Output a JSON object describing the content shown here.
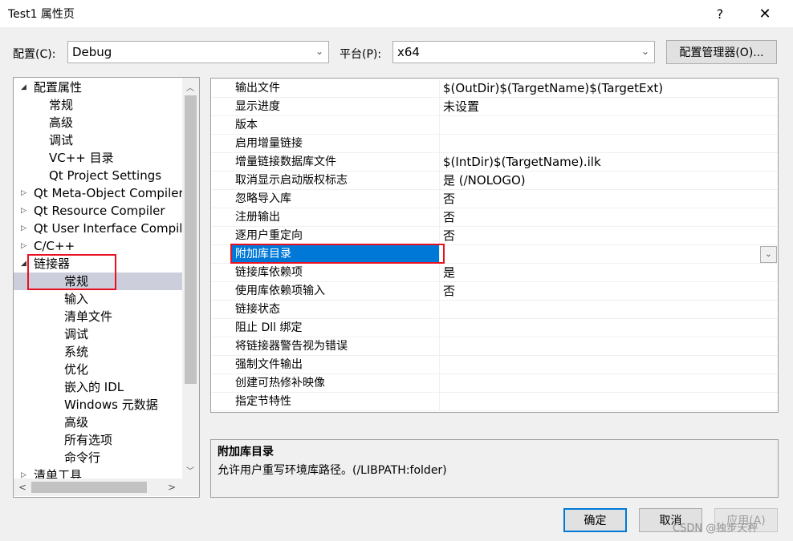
{
  "window": {
    "title": "Test1 属性页",
    "help_label": "?",
    "close_label": "✕"
  },
  "config": {
    "config_label": "配置(C):",
    "config_value": "Debug",
    "platform_label": "平台(P):",
    "platform_value": "x64",
    "manager_button": "配置管理器(O)..."
  },
  "tree": {
    "items": [
      {
        "label": "配置属性",
        "expander": "◢"
      },
      {
        "label": "常规"
      },
      {
        "label": "高级"
      },
      {
        "label": "调试"
      },
      {
        "label": "VC++ 目录"
      },
      {
        "label": "Qt Project Settings"
      },
      {
        "label": "Qt Meta-Object Compiler",
        "expander": "▷"
      },
      {
        "label": "Qt Resource Compiler",
        "expander": "▷"
      },
      {
        "label": "Qt User Interface Compiler",
        "expander": "▷"
      },
      {
        "label": "C/C++",
        "expander": "▷"
      },
      {
        "label": "链接器",
        "expander": "◢"
      },
      {
        "label": "常规"
      },
      {
        "label": "输入"
      },
      {
        "label": "清单文件"
      },
      {
        "label": "调试"
      },
      {
        "label": "系统"
      },
      {
        "label": "优化"
      },
      {
        "label": "嵌入的 IDL"
      },
      {
        "label": "Windows 元数据"
      },
      {
        "label": "高级"
      },
      {
        "label": "所有选项"
      },
      {
        "label": "命令行"
      },
      {
        "label": "清单工具",
        "expander": "▷"
      }
    ],
    "selected_index": 11
  },
  "properties": {
    "rows": [
      {
        "name": "输出文件",
        "value": "$(OutDir)$(TargetName)$(TargetExt)"
      },
      {
        "name": "显示进度",
        "value": "未设置"
      },
      {
        "name": "版本",
        "value": ""
      },
      {
        "name": "启用增量链接",
        "value": ""
      },
      {
        "name": "增量链接数据库文件",
        "value": "$(IntDir)$(TargetName).ilk"
      },
      {
        "name": "取消显示启动版权标志",
        "value": "是 (/NOLOGO)"
      },
      {
        "name": "忽略导入库",
        "value": "否"
      },
      {
        "name": "注册输出",
        "value": "否"
      },
      {
        "name": "逐用户重定向",
        "value": "否"
      },
      {
        "name": "附加库目录",
        "value": ""
      },
      {
        "name": "链接库依赖项",
        "value": "是"
      },
      {
        "name": "使用库依赖项输入",
        "value": "否"
      },
      {
        "name": "链接状态",
        "value": ""
      },
      {
        "name": "阻止 Dll 绑定",
        "value": ""
      },
      {
        "name": "将链接器警告视为错误",
        "value": ""
      },
      {
        "name": "强制文件输出",
        "value": ""
      },
      {
        "name": "创建可热修补映像",
        "value": ""
      },
      {
        "name": "指定节特性",
        "value": ""
      }
    ],
    "selected_index": 9
  },
  "description": {
    "title": "附加库目录",
    "text": "允许用户重写环境库路径。(/LIBPATH:folder)"
  },
  "buttons": {
    "ok": "确定",
    "cancel": "取消",
    "apply": "应用(A)"
  },
  "watermark": "CSDN @独步天秤",
  "colors": {
    "selection": "#0078d7",
    "tree_selection": "#cccedb",
    "highlight_box": "#e81123"
  }
}
